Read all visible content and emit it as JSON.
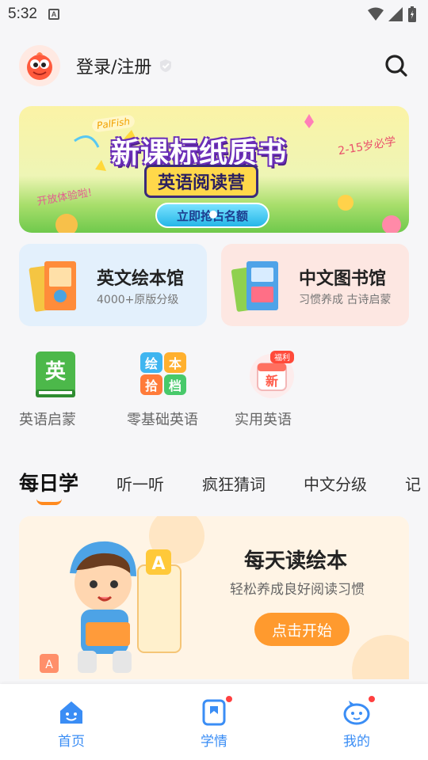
{
  "status_bar": {
    "time": "5:32",
    "sim_glyph": "A"
  },
  "header": {
    "login_label": "登录/注册"
  },
  "banner": {
    "brand": "PalFish",
    "title": "新课标纸质书",
    "subtitle": "英语阅读营",
    "age_tag": "2-15岁必学",
    "open_tag": "开放体验啦!",
    "cta": "立即抢占名额"
  },
  "cards": [
    {
      "title": "英文绘本馆",
      "subtitle": "4000+原版分级"
    },
    {
      "title": "中文图书馆",
      "subtitle": "习惯养成 古诗启蒙"
    }
  ],
  "quick_entries": [
    {
      "label": "英语启蒙",
      "icon": "english-book-icon",
      "glyph": "英"
    },
    {
      "label": "零基础英语",
      "icon": "picture-book-icon",
      "glyphs": [
        "绘",
        "本",
        "拾",
        "档"
      ]
    },
    {
      "label": "实用英语",
      "icon": "new-gift-icon",
      "glyph": "新",
      "badge": "福利"
    }
  ],
  "tabs": [
    "每日学",
    "听一听",
    "疯狂猜词",
    "中文分级",
    "记"
  ],
  "daily_card": {
    "title": "每天读绘本",
    "subtitle": "轻松养成良好阅读习惯",
    "button": "点击开始"
  },
  "bottom_nav": [
    {
      "label": "首页",
      "icon": "home-icon",
      "active": true
    },
    {
      "label": "学情",
      "icon": "study-report-icon",
      "badge": true
    },
    {
      "label": "我的",
      "icon": "profile-icon",
      "badge": true
    }
  ],
  "colors": {
    "accent": "#3a8df5",
    "orange": "#ff9a2e",
    "badge": "#ff4040"
  }
}
